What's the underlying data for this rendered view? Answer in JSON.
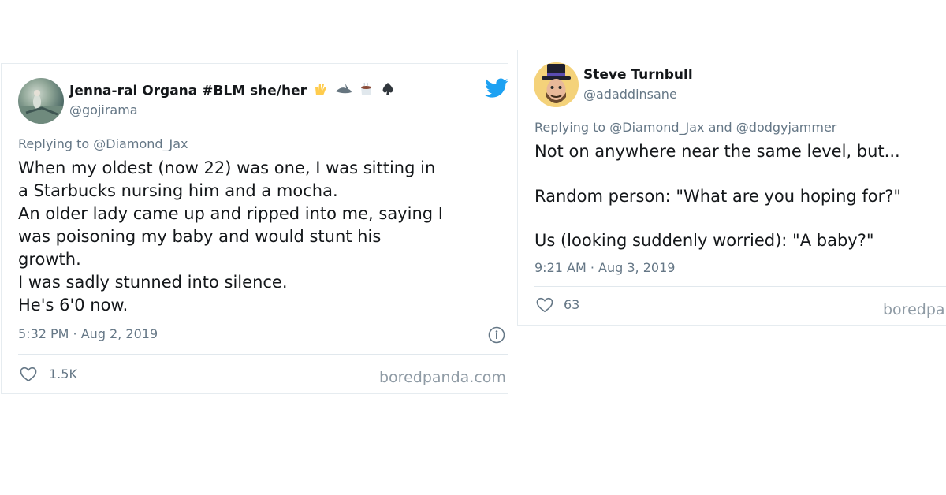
{
  "tweet_left": {
    "author_name": "Jenna-ral Organa #BLM she/her",
    "name_emojis": [
      "vulcan-salute-emoji",
      "shark-emoji",
      "coffee-emoji",
      "spade-emoji"
    ],
    "author_handle": "@gojirama",
    "replying_to": "Replying to @Diamond_Jax",
    "lines": [
      "When my oldest (now 22) was one, I was sitting in",
      "a Starbucks nursing him and a mocha.",
      "An older lady came up and ripped into me, saying I",
      "was poisoning my baby and would stunt his",
      "growth.",
      "I was sadly stunned into silence.",
      "He's 6'0 now."
    ],
    "timestamp": "5:32 PM · Aug 2, 2019",
    "likes": "1.5K",
    "watermark": "boredpanda.com",
    "brand_color": "#1da1f2"
  },
  "tweet_right": {
    "author_name": "Steve Turnbull",
    "author_handle": "@adaddinsane",
    "replying_to": "Replying to @Diamond_Jax and @dodgyjammer",
    "lines": [
      "Not on anywhere near the same level, but...",
      "Random person: \"What are you hoping for?\"",
      "Us (looking suddenly worried): \"A baby?\""
    ],
    "timestamp": "9:21 AM · Aug 3, 2019",
    "likes": "63",
    "watermark": "boredpanda.com"
  }
}
